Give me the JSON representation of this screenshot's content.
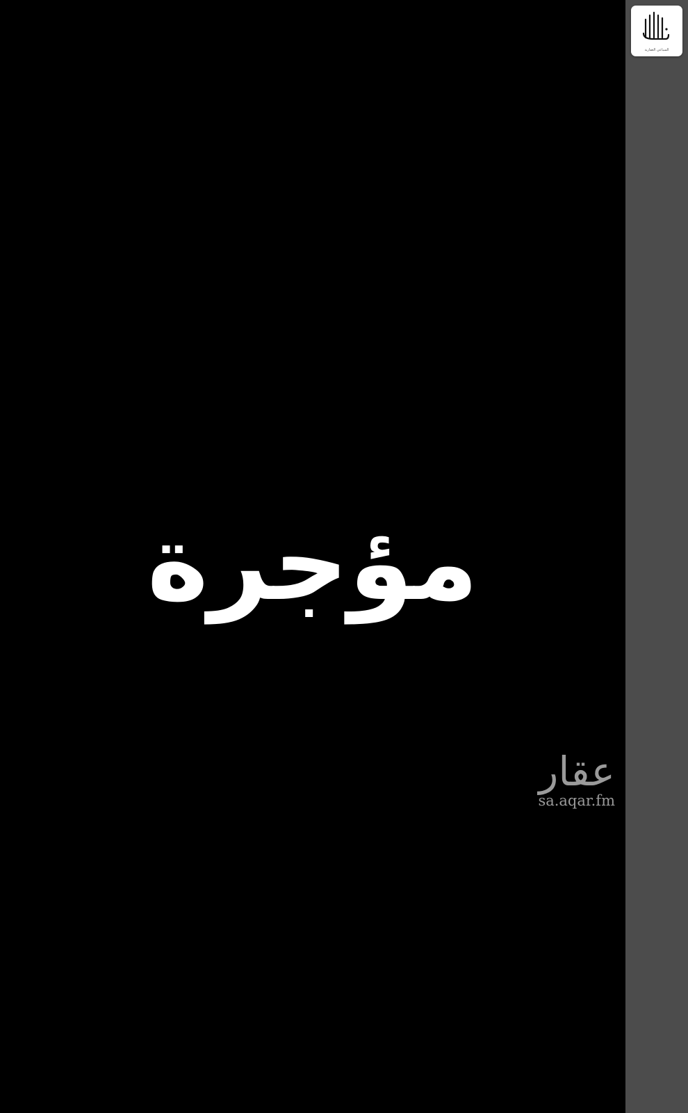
{
  "headline": "مؤجرة",
  "watermark": {
    "arabic": "عقار",
    "url": "sa.aqar.fm"
  },
  "logo": {
    "caption": "السباعي العقارية",
    "icon": "tall-letters-logo-icon"
  },
  "colors": {
    "background": "#000000",
    "side_panel": "#4c4c4c",
    "headline_text": "#ffffff",
    "watermark_text": "#9a9a9a",
    "logo_card": "#ffffff"
  }
}
